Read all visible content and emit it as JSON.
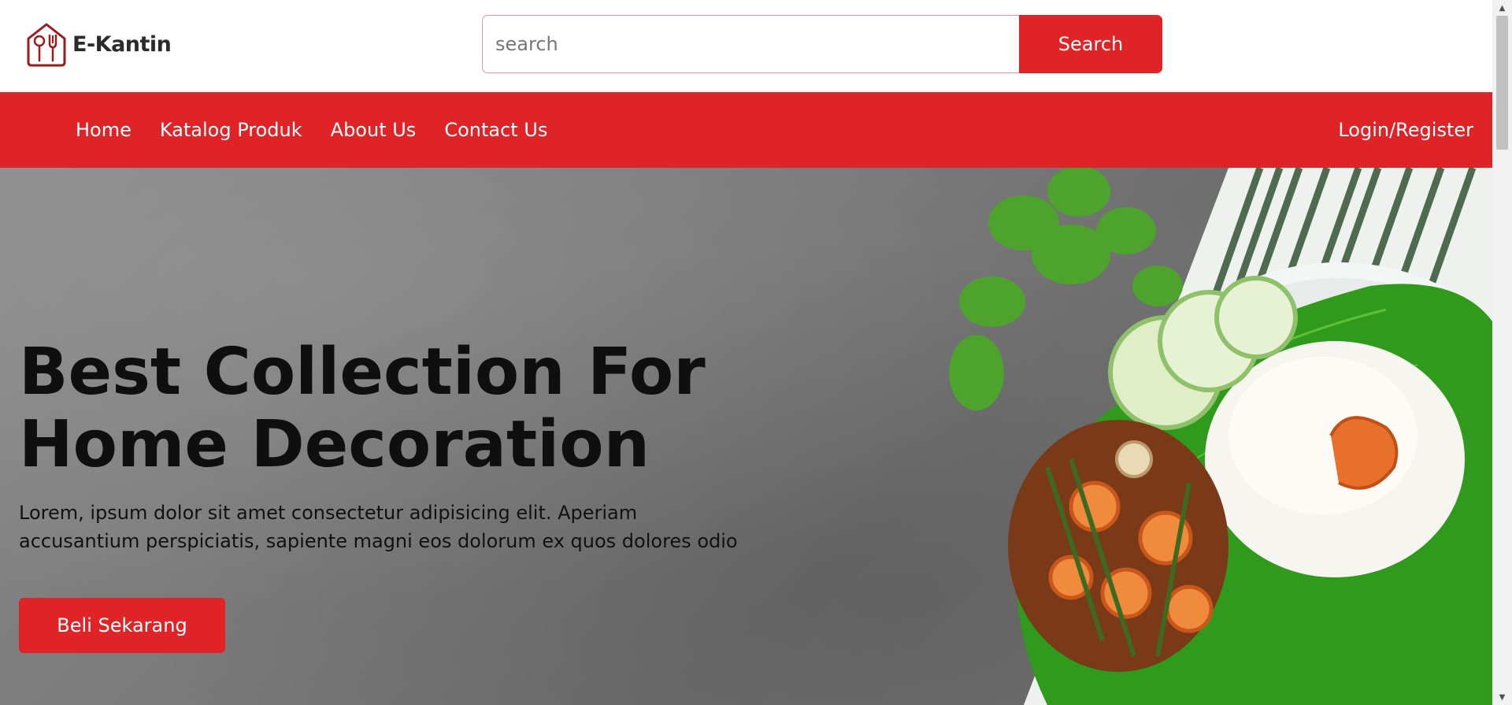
{
  "brand": {
    "name": "E-Kantin",
    "accent": "#e02327",
    "logo_icon": "house-utensils-icon"
  },
  "search": {
    "placeholder": "search",
    "value": "",
    "button_label": "Search"
  },
  "nav": {
    "items": [
      {
        "label": "Home"
      },
      {
        "label": "Katalog Produk"
      },
      {
        "label": "About Us"
      },
      {
        "label": "Contact Us"
      }
    ],
    "login_label": "Login/Register"
  },
  "hero": {
    "title_lines": [
      "Best Collection For",
      "Home Decoration"
    ],
    "description_lines": [
      "Lorem, ipsum dolor sit amet consectetur adipisicing elit. Aperiam",
      "accusantium perspiciatis, sapiente magni eos dolorum ex quos dolores odio"
    ],
    "cta_label": "Beli Sekarang",
    "image_icon": "shrimp-rice-plate-photo"
  },
  "scrollbar": {
    "up_icon": "scroll-up-arrow-icon",
    "down_icon": "scroll-down-arrow-icon"
  }
}
